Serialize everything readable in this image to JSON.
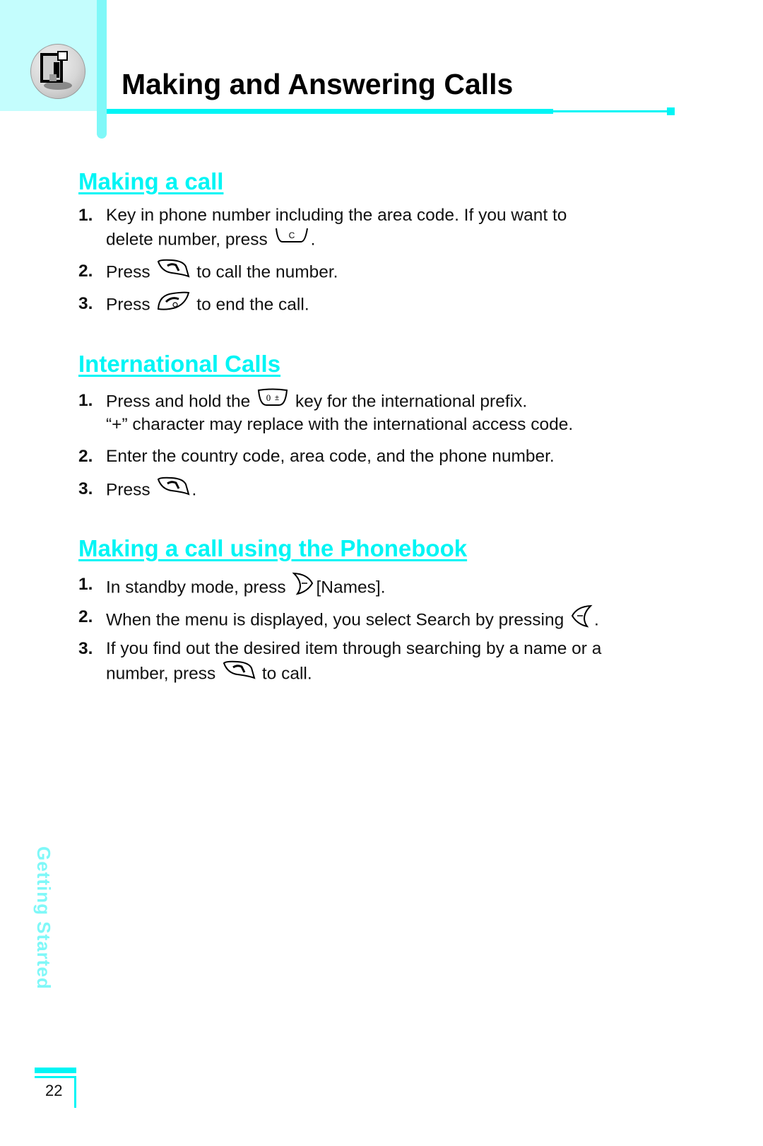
{
  "header": {
    "title": "Making and Answering Calls",
    "accent_color": "#00f5f5",
    "emblem_icon": "memo-note-icon"
  },
  "sections": [
    {
      "title": "Making a call",
      "items": [
        {
          "num": "1.",
          "lines": [
            "Key in phone number including the area code. If you want to",
            {
              "before": "delete number, press",
              "key": "clear-key-icon",
              "after": "."
            }
          ]
        },
        {
          "num": "2.",
          "before": "Press",
          "key": "send-key-icon",
          "after": "to call the number."
        },
        {
          "num": "3.",
          "before": "Press",
          "key": "end-key-icon",
          "after": "to end the call."
        }
      ]
    },
    {
      "title": "International Calls",
      "items": [
        {
          "num": "1.",
          "before": "Press and hold the",
          "key": "zero-plus-key-icon",
          "after": "key for the international prefix.",
          "line2": "“+” character may replace with the international access code."
        },
        {
          "num": "2.",
          "text": "Enter the country code, area code, and the phone number."
        },
        {
          "num": "3.",
          "before": "Press",
          "key": "send-key-icon",
          "after": "."
        }
      ]
    },
    {
      "title": "Making a call using the Phonebook",
      "items": [
        {
          "num": "1.",
          "before": "In standby mode, press",
          "key": "right-soft-key-icon",
          "after": "[Names]."
        },
        {
          "num": "2.",
          "before": "When the menu is displayed, you select Search by pressing",
          "key": "left-soft-key-icon",
          "after": "."
        },
        {
          "num": "3.",
          "line1": "If you find out the desired item through searching by a name or a",
          "before": "number, press",
          "key": "send-key-icon",
          "after": "to call."
        }
      ]
    }
  ],
  "sidebar": {
    "label": "Getting Started"
  },
  "footer": {
    "page_number": "22"
  }
}
